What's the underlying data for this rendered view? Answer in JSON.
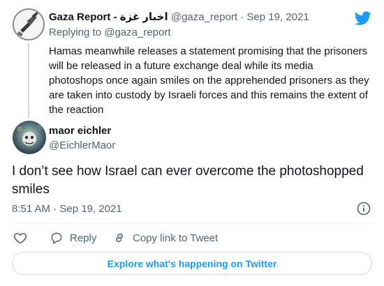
{
  "colors": {
    "accent": "#1d9bf0",
    "text": "#0f1419",
    "muted": "#536471",
    "border": "#cfd9de"
  },
  "parent_tweet": {
    "display_name": "Gaza Report - اخبار غزة",
    "handle": "@gaza_report",
    "date": "Sep 19, 2021",
    "replying_prefix": "Replying to",
    "replying_handle": "@gaza_report",
    "text": "Hamas meanwhile releases a statement promising that the prisoners will be released in a future exchange deal while its media photoshops once again smiles on the apprehended prisoners as they are taken into custody by Israeli forces and this remains the extent of the reaction",
    "avatar_icon": "hand-holding-gun-icon"
  },
  "main_tweet": {
    "display_name": "maor eichler",
    "handle": "@EichlerMaor",
    "text": "I don’t see how Israel can ever overcome the photoshopped smiles",
    "timestamp": "8:51 AM · Sep 19, 2021"
  },
  "actions": {
    "like_icon": "heart-icon",
    "reply_label": "Reply",
    "copy_label": "Copy link to Tweet"
  },
  "explore_button": {
    "label": "Explore what's happening on Twitter"
  },
  "brand_icon": "twitter-bird-icon"
}
